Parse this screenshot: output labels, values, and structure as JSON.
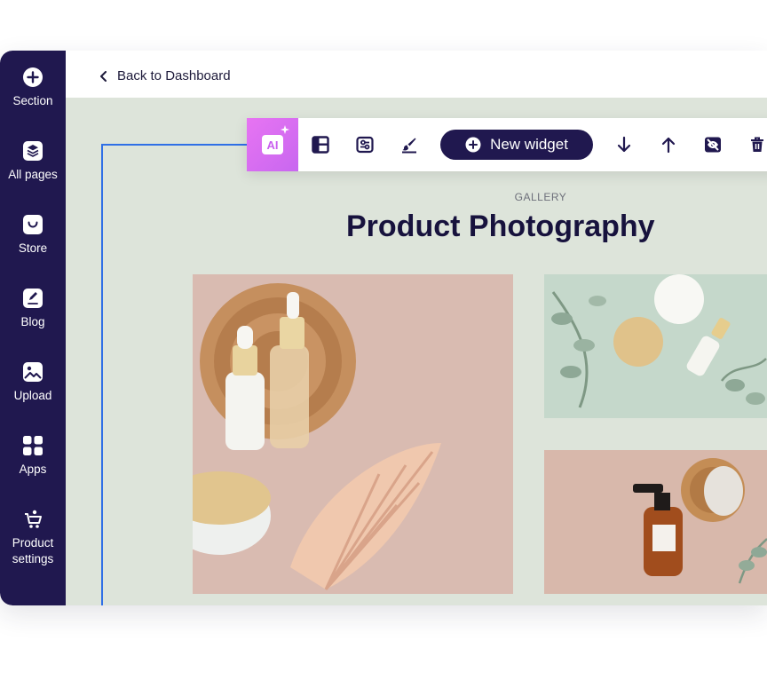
{
  "sidebar": {
    "items": [
      {
        "label": "Section",
        "icon": "plus-circle-icon"
      },
      {
        "label": "All pages",
        "icon": "layers-icon"
      },
      {
        "label": "Store",
        "icon": "shopping-bag-icon"
      },
      {
        "label": "Blog",
        "icon": "edit-note-icon"
      },
      {
        "label": "Upload",
        "icon": "image-upload-icon"
      },
      {
        "label": "Apps",
        "icon": "apps-grid-icon"
      },
      {
        "label": "Product\nsettings",
        "icon": "cart-settings-icon"
      }
    ]
  },
  "topbar": {
    "back_label": "Back to Dashboard"
  },
  "toolbar": {
    "ai_label": "AI",
    "new_widget_label": "New widget",
    "icons": [
      "layout-icon",
      "sliders-icon",
      "paint-brush-icon",
      "arrow-down-icon",
      "arrow-up-icon",
      "hide-eye-icon",
      "trash-icon"
    ]
  },
  "gallery": {
    "tag": "GALLERY",
    "title": "Product Photography"
  },
  "colors": {
    "sidebar": "#20184f",
    "canvas": "#dde4da",
    "accent_ai": "#e271f2",
    "guide": "#2f6fe6"
  }
}
